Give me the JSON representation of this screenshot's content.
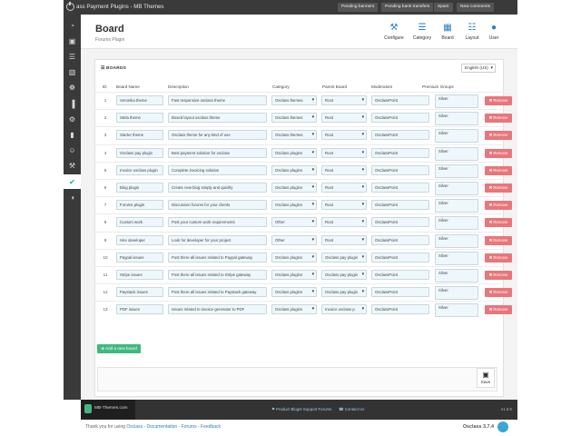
{
  "topbar": {
    "title": "ass Payment Plugins - MB Themes",
    "pills": [
      {
        "label": "Pending banners",
        "badge": "18",
        "badge_color": "#e8453c"
      },
      {
        "label": "Pending bank transfers",
        "badge": "2",
        "badge_color": "#e8453c"
      },
      {
        "label": "Spam",
        "badge": "0",
        "badge_color": "#e8453c"
      },
      {
        "label": "New comments",
        "badge": "1",
        "badge_color": "#7cc24a"
      }
    ]
  },
  "sidebar": {
    "items": [
      {
        "icon": "dashboard-icon",
        "glyph": "◔"
      },
      {
        "icon": "briefcase-icon",
        "glyph": "▣"
      },
      {
        "icon": "list-icon",
        "glyph": "☰"
      },
      {
        "icon": "image-icon",
        "glyph": "▧"
      },
      {
        "icon": "plug-icon",
        "glyph": "❁"
      },
      {
        "icon": "bar-chart-icon",
        "glyph": "▐"
      },
      {
        "icon": "cogs-icon",
        "glyph": "⚙"
      },
      {
        "icon": "book-icon",
        "glyph": "▮"
      },
      {
        "icon": "user-icon",
        "glyph": "☺"
      },
      {
        "icon": "tools-icon",
        "glyph": "⚒"
      },
      {
        "icon": "check-icon",
        "glyph": "✔"
      },
      {
        "icon": "toggle-icon",
        "glyph": "◑"
      }
    ]
  },
  "header": {
    "title": "Board",
    "subtitle": "Forums Plugin",
    "buttons": [
      {
        "label": "Configure",
        "icon": "wrench-icon",
        "glyph": "⚒"
      },
      {
        "label": "Category",
        "icon": "list-icon",
        "glyph": "☰"
      },
      {
        "label": "Board",
        "icon": "grid-icon",
        "glyph": "▦"
      },
      {
        "label": "Layout",
        "icon": "layout-icon",
        "glyph": "☷"
      },
      {
        "label": "User",
        "icon": "user-icon",
        "glyph": "●"
      }
    ]
  },
  "panel": {
    "title": "☰ BOARDS",
    "language": "English (US)",
    "columns": [
      "ID",
      "Board Name",
      "Description",
      "Category",
      "Parent Board",
      "Moderators",
      "Premium Groups"
    ],
    "rows": [
      {
        "id": "1",
        "name": "Veronika theme",
        "desc": "Fast responsive osclass theme",
        "category": "Osclass themes",
        "parent": "Root",
        "mods": "OsclassPoint",
        "groups": "Silver"
      },
      {
        "id": "2",
        "name": "Stela theme",
        "desc": "Boxed layout osclass theme",
        "category": "Osclass themes",
        "parent": "Root",
        "mods": "OsclassPoint",
        "groups": "Silver"
      },
      {
        "id": "3",
        "name": "Starter theme",
        "desc": "Osclass theme for any kind of use",
        "category": "Osclass themes",
        "parent": "Root",
        "mods": "OsclassPoint",
        "groups": "Silver"
      },
      {
        "id": "4",
        "name": "Osclass pay plugin",
        "desc": "Best payment solution for osclass",
        "category": "Osclass plugins",
        "parent": "Root",
        "mods": "OsclassPoint",
        "groups": "Silver"
      },
      {
        "id": "5",
        "name": "Invoice osclass plugin",
        "desc": "Complete invoicing solution",
        "category": "Osclass plugins",
        "parent": "Root",
        "mods": "OsclassPoint",
        "groups": "Silver"
      },
      {
        "id": "6",
        "name": "Blog plugin",
        "desc": "Create new blog simply and quickly",
        "category": "Osclass plugins",
        "parent": "Root",
        "mods": "OsclassPoint",
        "groups": "Silver"
      },
      {
        "id": "7",
        "name": "Forums plugin",
        "desc": "Discussion forums for your clients",
        "category": "Osclass plugins",
        "parent": "Root",
        "mods": "OsclassPoint",
        "groups": "Silver"
      },
      {
        "id": "8",
        "name": "Custom work",
        "desc": "Post your custom work requirements",
        "category": "Other",
        "parent": "Root",
        "mods": "OsclassPoint",
        "groups": "Silver"
      },
      {
        "id": "9",
        "name": "Hire developer",
        "desc": "Look for developer for your project",
        "category": "Other",
        "parent": "Root",
        "mods": "OsclassPoint",
        "groups": "Silver"
      },
      {
        "id": "10",
        "name": "Paypal issues",
        "desc": "Post there all issues related to Paypal gateway",
        "category": "Osclass plugins",
        "parent": "Osclass pay plugin",
        "mods": "OsclassPoint",
        "groups": "Silver"
      },
      {
        "id": "11",
        "name": "Stripe issues",
        "desc": "Post there all issues related to Stripe gateway",
        "category": "Osclass plugins",
        "parent": "Osclass pay plugin",
        "mods": "OsclassPoint",
        "groups": "Silver"
      },
      {
        "id": "12",
        "name": "Paystack issues",
        "desc": "Post there all issues related to Paystack gateway",
        "category": "Osclass plugins",
        "parent": "Osclass pay plugin",
        "mods": "OsclassPoint",
        "groups": "Silver"
      },
      {
        "id": "13",
        "name": "PDF issues",
        "desc": "Issues related to invoice generator to PDF",
        "category": "Osclass plugins",
        "parent": "Invoice osclass p",
        "mods": "OsclassPoint",
        "groups": "Silver"
      }
    ],
    "remove_label": "✖ Remove",
    "add_label": "⊕ Add a new board",
    "save_label": "Save"
  },
  "footer": {
    "logo_text": "MB-Themes.com",
    "links": [
      "⚑ Product Blog",
      "✉ Support Forums",
      "☎ Contact Us"
    ],
    "version": "v1.0.0"
  },
  "bottom": {
    "thanks": "Thank you for using ",
    "osclass": "Osclass",
    "sep1": " - ",
    "doc": "Documentation",
    "sep2": " - ",
    "forums": "Forums",
    "sep3": " - ",
    "feedback": "Feedback",
    "brand": "Osclass 3.7.4"
  }
}
